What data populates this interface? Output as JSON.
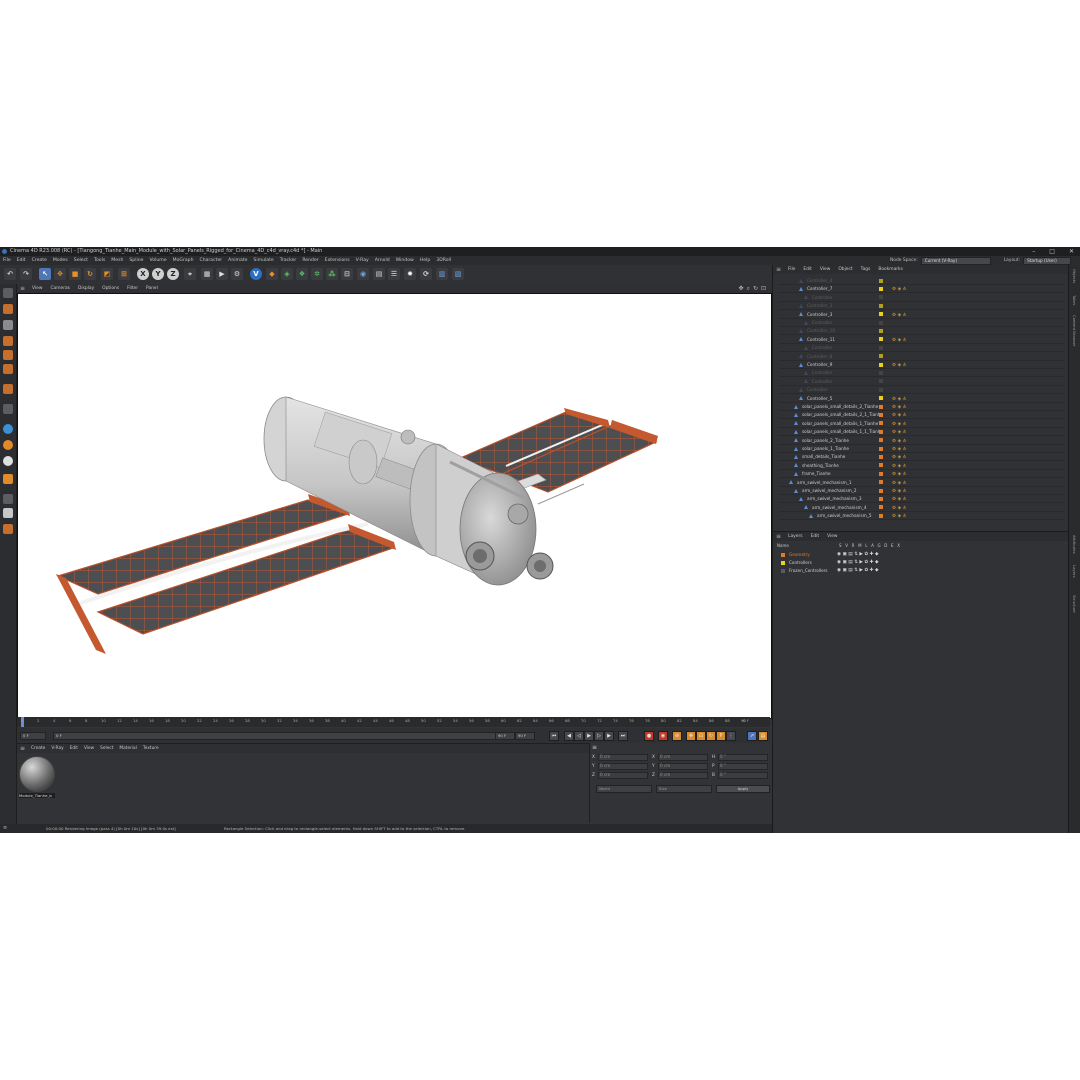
{
  "window": {
    "title": "Cinema 4D R23.008 (RC) - [Tiangong_Tianhe_Main_Module_with_Solar_Panels_Rigged_for_Cinema_4D_c4d_vray.c4d *] - Main"
  },
  "menu": [
    "File",
    "Edit",
    "Create",
    "Modes",
    "Select",
    "Tools",
    "Mesh",
    "Spline",
    "Volume",
    "MoGraph",
    "Character",
    "Animate",
    "Simulate",
    "Tracker",
    "Render",
    "Extensions",
    "V-Ray",
    "Arnold",
    "Window",
    "Help",
    "3DRoll"
  ],
  "node_space": {
    "label": "Node Space:",
    "value": "Current (V-Ray)"
  },
  "layout": {
    "label": "Layout:",
    "value": "Startup (User)"
  },
  "toolbar": {
    "axis_x": "X",
    "axis_y": "Y",
    "axis_z": "Z"
  },
  "viewport_menu": [
    "View",
    "Cameras",
    "Display",
    "Options",
    "Filter",
    "Panel"
  ],
  "timeline": {
    "ticks": [
      "0",
      "2",
      "4",
      "6",
      "8",
      "10",
      "12",
      "14",
      "16",
      "18",
      "20",
      "22",
      "24",
      "26",
      "28",
      "30",
      "32",
      "34",
      "36",
      "38",
      "40",
      "42",
      "44",
      "46",
      "48",
      "50",
      "52",
      "54",
      "56",
      "58",
      "60",
      "62",
      "64",
      "66",
      "68",
      "70",
      "72",
      "74",
      "76",
      "78",
      "80",
      "82",
      "84",
      "86",
      "88",
      "90"
    ],
    "end_label": "0 F"
  },
  "transport": {
    "start": "0 F",
    "current": "0 F",
    "end": "90 F",
    "max": "90 F"
  },
  "material_manager": {
    "menu": [
      "Create",
      "V-Ray",
      "Edit",
      "View",
      "Select",
      "Material",
      "Texture"
    ],
    "materials": [
      {
        "name": "Module_Tianhe_b"
      }
    ]
  },
  "coordinates": {
    "rows": [
      {
        "axis": "X",
        "pos": "0 cm",
        "axis2": "X",
        "size": "0 cm",
        "axis3": "H",
        "rot": "0 °"
      },
      {
        "axis": "Y",
        "pos": "0 cm",
        "axis2": "Y",
        "size": "0 cm",
        "axis3": "P",
        "rot": "0 °"
      },
      {
        "axis": "Z",
        "pos": "0 cm",
        "axis2": "Z",
        "size": "0 cm",
        "axis3": "B",
        "rot": "0 °"
      }
    ],
    "mode": "World",
    "size_mode": "Size",
    "apply": "Apply"
  },
  "status": {
    "render": "00:00:00 Rendering Image (pass 4) [0h 0m 10s] [0h 0m 39.0s est]",
    "hint": "Rectangle Selection: Click and drag to rectangle-select elements. Hold down SHIFT to add to the selection, CTRL to remove."
  },
  "object_manager": {
    "menu": [
      "File",
      "Edit",
      "View",
      "Object",
      "Tags",
      "Bookmarks"
    ],
    "rows": [
      {
        "name": "Controller_4",
        "indent": 2,
        "dim": true,
        "color": "#b0a020"
      },
      {
        "name": "Controller_7",
        "indent": 2,
        "dim": false,
        "color": "#e8d21f"
      },
      {
        "name": "Controller",
        "indent": 3,
        "dim": true,
        "color": "#444"
      },
      {
        "name": "Controller_3",
        "indent": 2,
        "dim": true,
        "color": "#b0a020"
      },
      {
        "name": "Controller_3",
        "indent": 2,
        "dim": false,
        "color": "#e8d21f"
      },
      {
        "name": "Controller",
        "indent": 3,
        "dim": true,
        "color": "#444"
      },
      {
        "name": "Controller_10",
        "indent": 2,
        "dim": true,
        "color": "#b0a020"
      },
      {
        "name": "Controller_11",
        "indent": 2,
        "dim": false,
        "color": "#e8d21f"
      },
      {
        "name": "Controller",
        "indent": 3,
        "dim": true,
        "color": "#444"
      },
      {
        "name": "Controller_8",
        "indent": 2,
        "dim": true,
        "color": "#b0a020"
      },
      {
        "name": "Controller_9",
        "indent": 2,
        "dim": false,
        "color": "#e8d21f"
      },
      {
        "name": "Controller",
        "indent": 3,
        "dim": true,
        "color": "#444"
      },
      {
        "name": "Controller",
        "indent": 3,
        "dim": true,
        "color": "#444"
      },
      {
        "name": "Controller",
        "indent": 2,
        "dim": true,
        "color": "#444"
      },
      {
        "name": "Controller_5",
        "indent": 2,
        "dim": false,
        "color": "#e8d21f"
      },
      {
        "name": "solar_panels_small_details_2_Tianhe",
        "indent": 1,
        "dim": false,
        "color": "#e07b2a"
      },
      {
        "name": "solar_panels_small_details_2_1_Tianhe",
        "indent": 1,
        "dim": false,
        "color": "#e07b2a"
      },
      {
        "name": "solar_panels_small_details_1_Tianhe",
        "indent": 1,
        "dim": false,
        "color": "#e07b2a"
      },
      {
        "name": "solar_panels_small_details_1_1_Tianhe",
        "indent": 1,
        "dim": false,
        "color": "#e07b2a"
      },
      {
        "name": "solar_panels_2_Tianhe",
        "indent": 1,
        "dim": false,
        "color": "#e07b2a"
      },
      {
        "name": "solar_panels_1_Tianhe",
        "indent": 1,
        "dim": false,
        "color": "#e07b2a"
      },
      {
        "name": "small_details_Tianhe",
        "indent": 1,
        "dim": false,
        "color": "#e07b2a"
      },
      {
        "name": "sheathing_Tianhe",
        "indent": 1,
        "dim": false,
        "color": "#e07b2a"
      },
      {
        "name": "frame_Tianhe",
        "indent": 1,
        "dim": false,
        "color": "#e07b2a"
      },
      {
        "name": "arm_swivel_mechanism_1",
        "indent": 0,
        "dim": false,
        "color": "#e07b2a"
      },
      {
        "name": "arm_swivel_mechanism_2",
        "indent": 1,
        "dim": false,
        "color": "#e07b2a"
      },
      {
        "name": "arm_swivel_mechanism_3",
        "indent": 2,
        "dim": false,
        "color": "#e07b2a"
      },
      {
        "name": "arm_swivel_mechanism_4",
        "indent": 3,
        "dim": false,
        "color": "#e07b2a"
      },
      {
        "name": "arm_swivel_mechanism_5",
        "indent": 4,
        "dim": false,
        "color": "#e07b2a"
      }
    ]
  },
  "layers": {
    "menu": [
      "Layers",
      "Edit",
      "View"
    ],
    "header": {
      "name": "Name",
      "cols": "S V R M L A G D E X"
    },
    "rows": [
      {
        "name": "Geometry",
        "color": "#e07b2a"
      },
      {
        "name": "Controllers",
        "color": "#e8d21f"
      },
      {
        "name": "Frozen_Controllers",
        "color": "#5a5a5a"
      }
    ]
  },
  "side_tabs": [
    "Objects",
    "Takes",
    "Content Browser",
    "Attributes",
    "Layers",
    "Structure"
  ],
  "colors": {
    "accent": "#5f8ccf",
    "orange": "#e07b2a",
    "yellow": "#e8d21f",
    "panel": "#333437"
  }
}
